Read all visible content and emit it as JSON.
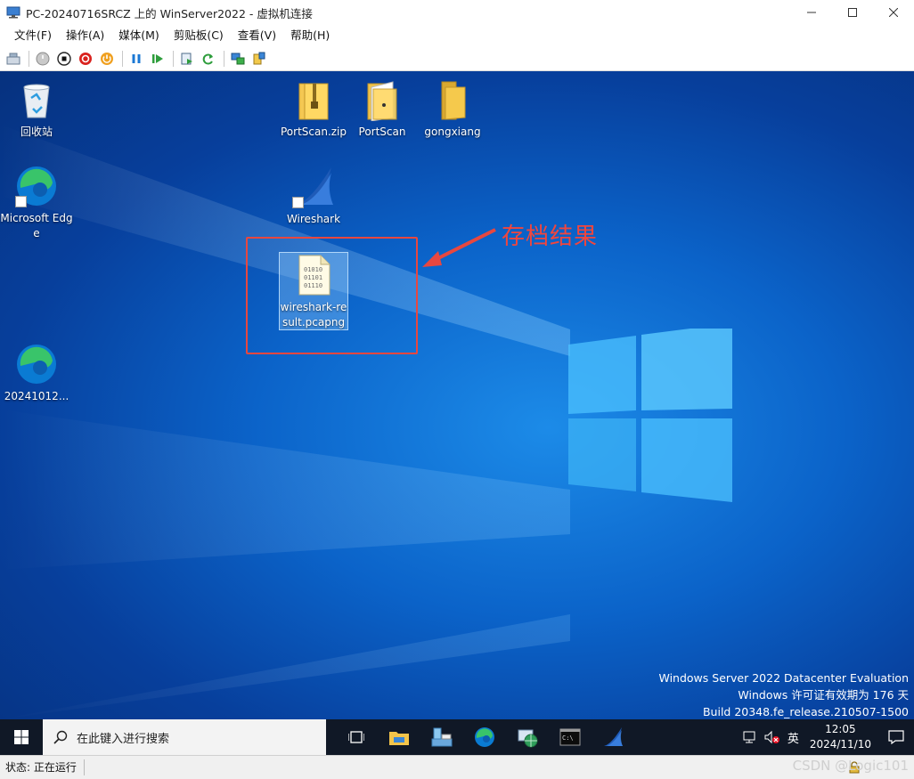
{
  "window": {
    "title": "PC-20240716SRCZ 上的 WinServer2022 - 虚拟机连接"
  },
  "menu": [
    "文件(F)",
    "操作(A)",
    "媒体(M)",
    "剪贴板(C)",
    "查看(V)",
    "帮助(H)"
  ],
  "desktop_icons": {
    "recycle_bin": "回收站",
    "edge": "Microsoft Edge",
    "edge2": "20241012...",
    "portscan_zip": "PortScan.zip",
    "portscan": "PortScan",
    "gongxiang": "gongxiang",
    "wireshark": "Wireshark",
    "pcap": "wireshark-result.pcapng"
  },
  "annotation": {
    "text": "存档结果",
    "color": "#e8473f"
  },
  "watermark": {
    "line1": "Windows Server 2022 Datacenter Evaluation",
    "line2": "Windows 许可证有效期为 176 天",
    "line3": "Build 20348.fe_release.210507-1500"
  },
  "taskbar": {
    "search_placeholder": "在此键入进行搜索",
    "ime": "英",
    "time": "12:05",
    "date": "2024/11/10"
  },
  "statusbar": {
    "status": "状态: 正在运行",
    "csdn": "CSDN @Logic101"
  }
}
